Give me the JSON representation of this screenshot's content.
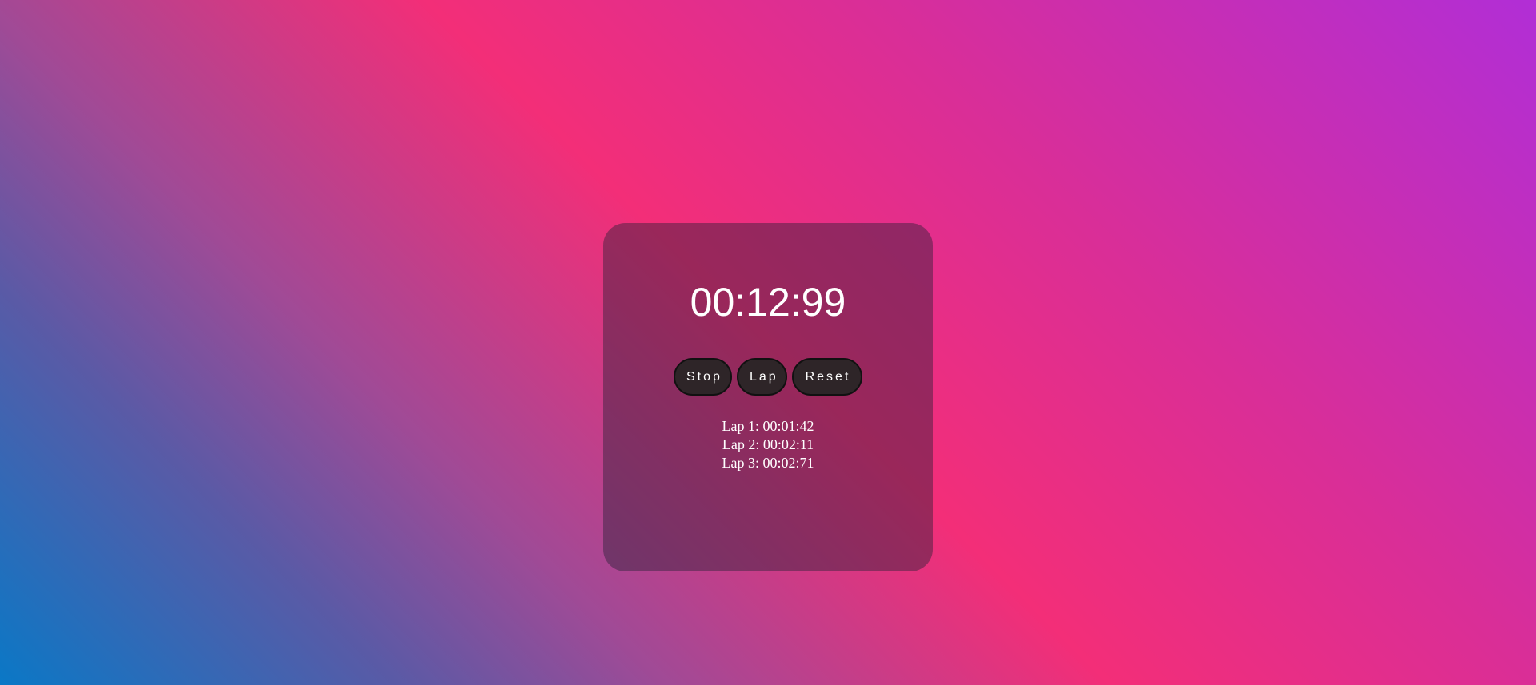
{
  "stopwatch": {
    "time": "00:12:99",
    "buttons": {
      "stop": "Stop",
      "lap": "Lap",
      "reset": "Reset"
    },
    "laps": [
      "Lap 1: 00:01:42",
      "Lap 2: 00:02:11",
      "Lap 3: 00:02:71"
    ]
  },
  "colors": {
    "gradient": [
      "#0a78c6",
      "#a04a96",
      "#f32e78",
      "#d92e98",
      "#b12ed6"
    ],
    "button_bg": "#2e2528",
    "text": "#ffffff"
  }
}
